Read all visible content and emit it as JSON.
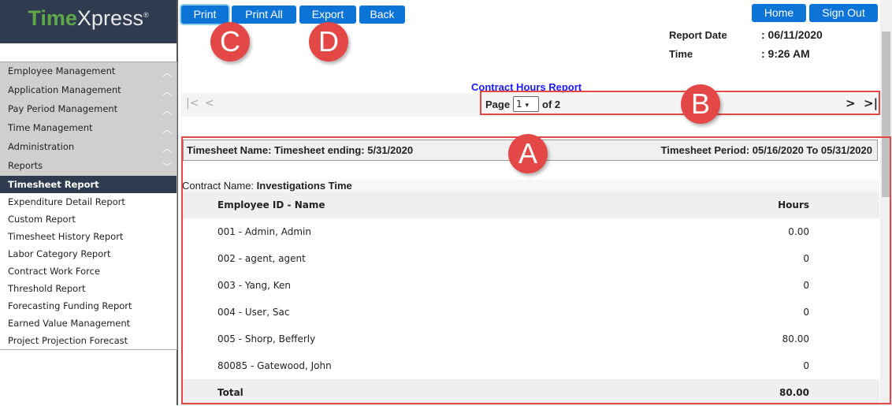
{
  "logo": {
    "brand_a": "Time",
    "brand_b": "Xpress",
    "mark": "®"
  },
  "menu": [
    {
      "label": "Employee Management",
      "icon": "chevron-up-icon"
    },
    {
      "label": "Application Management",
      "icon": "chevron-up-icon"
    },
    {
      "label": "Pay Period Management",
      "icon": "chevron-up-icon"
    },
    {
      "label": "Time Management",
      "icon": "chevron-up-icon"
    },
    {
      "label": "Administration",
      "icon": "chevron-up-icon"
    },
    {
      "label": "Reports",
      "icon": "chevron-down-icon"
    }
  ],
  "submenu": [
    "Timesheet Report",
    "Expenditure Detail Report",
    "Custom Report",
    "Timesheet History Report",
    "Labor Category Report",
    "Contract Work Force",
    "Threshold Report",
    "Forecasting Funding Report",
    "Earned Value Management",
    "Project Projection Forecast"
  ],
  "toolbar": {
    "print": "Print",
    "print_all": "Print All",
    "export": "Export",
    "back": "Back",
    "home": "Home",
    "sign_out": "Sign Out"
  },
  "report": {
    "date_label": "Report Date",
    "date_value": ": 06/11/2020",
    "time_label": "Time",
    "time_value": ": 9:26 AM",
    "title": "Contract Hours Report"
  },
  "pager": {
    "page_label": "Page",
    "page_value": "1",
    "of_label": "of 2"
  },
  "timesheet": {
    "name": "Timesheet Name: Timesheet ending: 5/31/2020",
    "period": "Timesheet Period: 05/16/2020 To 05/31/2020"
  },
  "contract": {
    "label": "Contract Name: ",
    "value": "Investigations Time"
  },
  "table": {
    "headers": [
      "Employee ID - Name",
      "Hours"
    ],
    "rows": [
      [
        "001 - Admin, Admin",
        "0.00"
      ],
      [
        "002 - agent, agent",
        "0"
      ],
      [
        "003 - Yang, Ken",
        "0"
      ],
      [
        "004 - User, Sac",
        "0"
      ],
      [
        "005 - Shorp, Befferly",
        "80.00"
      ],
      [
        "80085 - Gatewood, John",
        "0"
      ]
    ],
    "total": [
      "Total",
      "80.00"
    ]
  },
  "annotations": [
    "A",
    "B",
    "C",
    "D"
  ],
  "colors": {
    "accent": "#0b74d6",
    "sidebar": "#2f3b4e",
    "annotation": "#e34846"
  }
}
